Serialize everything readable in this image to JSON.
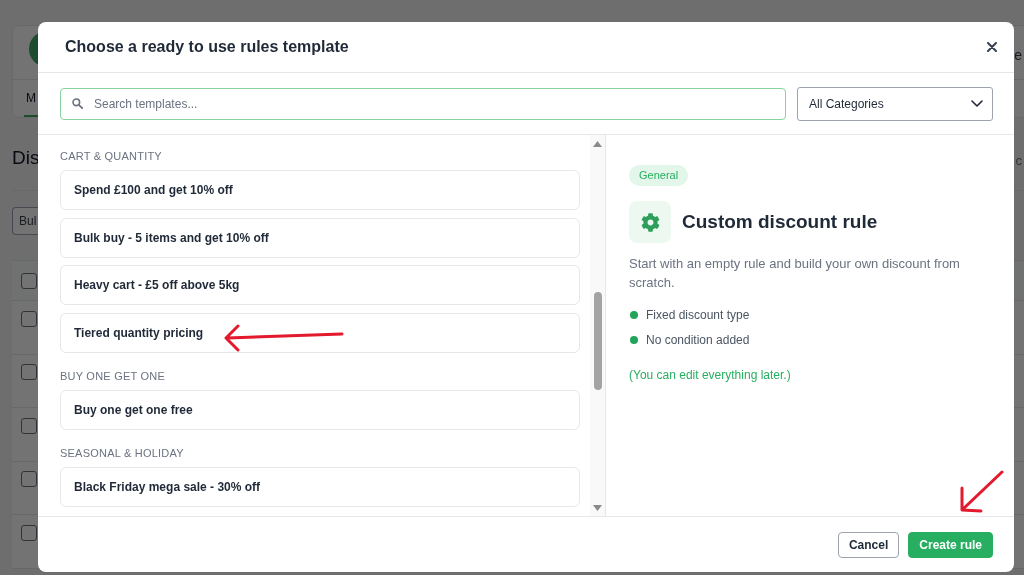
{
  "background_page": {
    "header_text": "e",
    "tabs": [
      {
        "label": "M",
        "selected": true
      }
    ],
    "heading": "Dis",
    "toolbar_text": "c",
    "bulk_button": "Bul",
    "table": {
      "header": {
        "checked": false
      },
      "rows": [
        {
          "checked": false
        },
        {
          "checked": false
        },
        {
          "checked": false
        },
        {
          "checked": false
        },
        {
          "checked": false
        }
      ]
    }
  },
  "dialog": {
    "title": "Choose a ready to use rules template",
    "search": {
      "placeholder": "Search templates..."
    },
    "category_select": {
      "value": "All Categories"
    },
    "template_groups": [
      {
        "heading": "CART & QUANTITY",
        "templates": [
          {
            "label": "Spend £100 and get 10% off",
            "selected": false
          },
          {
            "label": "Bulk buy - 5 items and get 10% off",
            "selected": false
          },
          {
            "label": "Heavy cart - £5 off above 5kg",
            "selected": false
          },
          {
            "label": "Tiered quantity pricing",
            "selected": false
          }
        ]
      },
      {
        "heading": "BUY ONE GET ONE",
        "templates": [
          {
            "label": "Buy one get one free",
            "selected": false
          }
        ]
      },
      {
        "heading": "SEASONAL & HOLIDAY",
        "templates": [
          {
            "label": "Black Friday mega sale - 30% off",
            "selected": false
          }
        ]
      }
    ],
    "preview": {
      "badge": "General",
      "title": "Custom discount rule",
      "description": "Start with an empty rule and build your own discount from scratch.",
      "features": [
        "Fixed discount type",
        "No condition added"
      ],
      "note": "(You can edit everything later.)"
    },
    "buttons": [
      {
        "kind": "secondary",
        "label": "Cancel"
      },
      {
        "kind": "primary",
        "label": "Create rule"
      }
    ]
  }
}
